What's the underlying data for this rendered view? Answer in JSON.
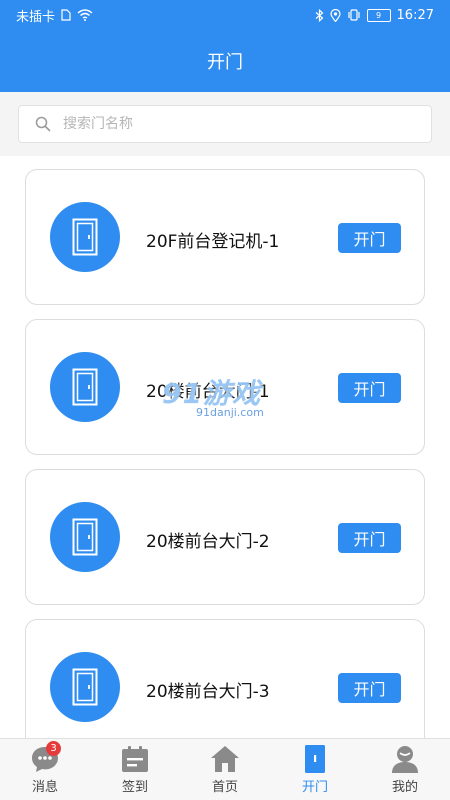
{
  "status_bar": {
    "carrier": "未插卡",
    "battery": "9",
    "time": "16:27"
  },
  "header": {
    "title": "开门"
  },
  "search": {
    "placeholder": "搜索门名称"
  },
  "doors": [
    {
      "name": "20F前台登记机-1",
      "button": "开门"
    },
    {
      "name": "20楼前台大门-1",
      "button": "开门"
    },
    {
      "name": "20楼前台大门-2",
      "button": "开门"
    },
    {
      "name": "20楼前台大门-3",
      "button": "开门"
    }
  ],
  "watermark": {
    "logo": "91游戏",
    "site": "91danji.com"
  },
  "tabs": [
    {
      "label": "消息",
      "icon": "message-icon",
      "badge": "3"
    },
    {
      "label": "签到",
      "icon": "calendar-icon"
    },
    {
      "label": "首页",
      "icon": "home-icon"
    },
    {
      "label": "开门",
      "icon": "door-icon",
      "active": true
    },
    {
      "label": "我的",
      "icon": "profile-icon"
    }
  ],
  "colors": {
    "primary": "#2f8cf0",
    "tab_inactive_icon": "#8a8a8a",
    "badge": "#e63b3b"
  }
}
